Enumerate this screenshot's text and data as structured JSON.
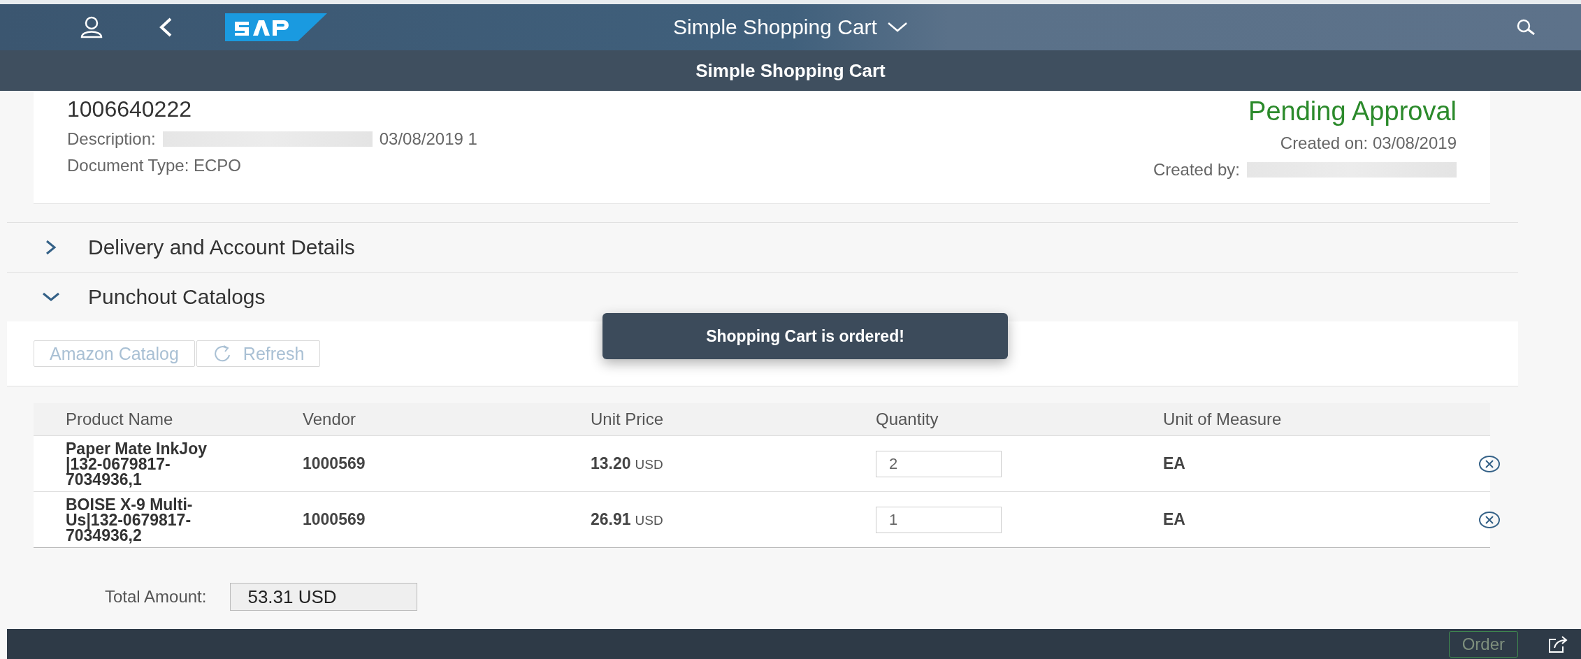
{
  "shell": {
    "title": "Simple Shopping Cart"
  },
  "page_header": {
    "title": "Simple Shopping Cart"
  },
  "object_header": {
    "number": "1006640222",
    "description_label": "Description:",
    "description_value": "03/08/2019 1",
    "document_type": "Document Type: ECPO",
    "status": "Pending Approval",
    "created_on": "Created on: 03/08/2019",
    "created_by_label": "Created by:"
  },
  "panels": [
    {
      "title": "Delivery and Account Details",
      "expanded": false
    },
    {
      "title": "Punchout Catalogs",
      "expanded": true
    }
  ],
  "toolbar": [
    {
      "kind": "text",
      "label": "Amazon Catalog",
      "disabled": true
    },
    {
      "kind": "refresh",
      "label": "Refresh",
      "disabled": true
    }
  ],
  "toast": "Shopping Cart is ordered!",
  "table": {
    "columns": [
      "Product Name",
      "Vendor",
      "Unit Price",
      "Quantity",
      "Unit of Measure"
    ],
    "rows": [
      {
        "product": "Paper Mate InkJoy |132-0679817-7034936,1",
        "vendor": "1000569",
        "price": "13.20",
        "currency": "USD",
        "quantity": "2",
        "unit": "EA"
      },
      {
        "product": "BOISE X-9 Multi-Us|132-0679817-7034936,2",
        "vendor": "1000569",
        "price": "26.91",
        "currency": "USD",
        "quantity": "1",
        "unit": "EA"
      }
    ]
  },
  "total": {
    "label": "Total Amount:",
    "value": "53.31 USD"
  },
  "footer": {
    "button": "Order"
  }
}
